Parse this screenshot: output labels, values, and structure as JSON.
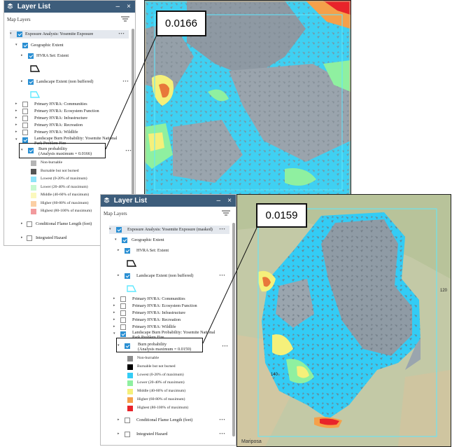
{
  "top": {
    "header_title": "Layer List",
    "map_layers_label": "Map Layers",
    "callout_value": "0.0166",
    "items": {
      "exposure": "Exposure Analysis: Yosemite Exposure",
      "geographic": "Geographic Extent",
      "hvra_set": "HVRA Set: Extent",
      "landscape": "Landscape Extent (non buffered)",
      "communities": "Primary HVRA: Communities",
      "ecosystem": "Primary HVRA: Ecosystem Function",
      "infrastructure": "Primary HVRA: Infrastructure",
      "recreation": "Primary HVRA: Recreation",
      "wildlife": "Primary HVRA: Wildlife",
      "burnprob_group": "Landscape Burn Probability: Yosemite National Park Problem Fire",
      "burnprob": "Burn probability",
      "burnprob_sub": "(Analysis maximum = 0.0166)",
      "flame": "Conditional Flame Length (feet)",
      "integrated": "Integrated Hazard"
    }
  },
  "bottom": {
    "header_title": "Layer List",
    "map_layers_label": "Map Layers",
    "callout_value": "0.0159",
    "items": {
      "exposure": "Exposure Analysis: Yosemite Exposure (masked)",
      "geographic": "Geographic Extent",
      "hvra_set": "HVRA Set: Extent",
      "landscape": "Landscape Extent (non buffered)",
      "communities": "Primary HVRA: Communities",
      "ecosystem": "Primary HVRA: Ecosystem Function",
      "infrastructure": "Primary HVRA: Infrastructure",
      "recreation": "Primary HVRA: Recreation",
      "wildlife": "Primary HVRA: Wildlife",
      "burnprob_group": "Landscape Burn Probability: Yosemite National Park Problem Fire",
      "burnprob": "Burn probability",
      "burnprob_sub": "(Analysis maximum = 0.0159)",
      "flame": "Conditional Flame Length (feet)",
      "integrated": "Integrated Hazard"
    },
    "map_labels": {
      "mariposa": "Mariposa",
      "route_140": "140",
      "route_120": "120"
    }
  },
  "legend": [
    {
      "label": "Non-burnable",
      "color": "#8c8c8c"
    },
    {
      "label": "Burnable but not burned",
      "color": "#000000"
    },
    {
      "label": "Lowest (0-20% of maximum)",
      "color": "#33ccf5"
    },
    {
      "label": "Lower (20-40% of maximum)",
      "color": "#8ff0a0"
    },
    {
      "label": "Middle (40-60% of maximum)",
      "color": "#f5f07a"
    },
    {
      "label": "Higher (60-80% of maximum)",
      "color": "#f5a04a"
    },
    {
      "label": "Highest (80-100% of maximum)",
      "color": "#e8232a"
    }
  ],
  "top_legend_colors": [
    "#b5b5b5",
    "#555555",
    "#8fe3f8",
    "#c6f8cf",
    "#fbf8bd",
    "#fbcfa4",
    "#f29a9d"
  ]
}
